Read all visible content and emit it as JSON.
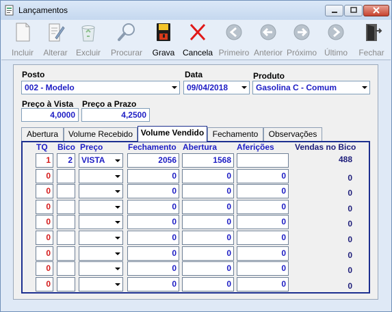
{
  "window": {
    "title": "Lançamentos"
  },
  "toolbar": {
    "items": [
      {
        "label": "Incluir",
        "icon": "new-document-icon",
        "enabled": false
      },
      {
        "label": "Alterar",
        "icon": "edit-document-icon",
        "enabled": false
      },
      {
        "label": "Excluir",
        "icon": "recycle-bin-icon",
        "enabled": false
      },
      {
        "label": "Procurar",
        "icon": "magnifier-icon",
        "enabled": false
      },
      {
        "label": "Grava",
        "icon": "floppy-disk-icon",
        "enabled": true
      },
      {
        "label": "Cancela",
        "icon": "red-x-icon",
        "enabled": true
      },
      {
        "label": "Primeiro",
        "icon": "first-record-icon",
        "enabled": false
      },
      {
        "label": "Anterior",
        "icon": "previous-record-icon",
        "enabled": false
      },
      {
        "label": "Próximo",
        "icon": "next-record-icon",
        "enabled": false
      },
      {
        "label": "Último",
        "icon": "last-record-icon",
        "enabled": false
      },
      {
        "label": "Fechar",
        "icon": "exit-door-icon",
        "enabled": false
      }
    ]
  },
  "form": {
    "posto": {
      "label": "Posto",
      "value": "002 - Modelo"
    },
    "data": {
      "label": "Data",
      "value": "09/04/2018"
    },
    "produto": {
      "label": "Produto",
      "value": "Gasolina C - Comum"
    },
    "preco_vista": {
      "label": "Preço à Vista",
      "value": "4,0000"
    },
    "preco_prazo": {
      "label": "Preço a Prazo",
      "value": "4,2500"
    }
  },
  "tabs": [
    {
      "label": "Abertura",
      "active": false
    },
    {
      "label": "Volume Recebido",
      "active": false
    },
    {
      "label": "Volume Vendido",
      "active": true
    },
    {
      "label": "Fechamento",
      "active": false
    },
    {
      "label": "Observações",
      "active": false
    }
  ],
  "grid": {
    "headers": {
      "tq": "TQ",
      "bico": "Bico",
      "preco": "Preço",
      "fechamento": "Fechamento",
      "abertura": "Abertura",
      "afericoes": "Aferições",
      "vendas": "Vendas no Bico"
    },
    "rows": [
      {
        "tq": "1",
        "bico": "2",
        "preco": "VISTA",
        "fechamento": "2056",
        "abertura": "1568",
        "afericoes": "",
        "vendas": "488"
      },
      {
        "tq": "0",
        "bico": "",
        "preco": "",
        "fechamento": "0",
        "abertura": "0",
        "afericoes": "0",
        "vendas": "0"
      },
      {
        "tq": "0",
        "bico": "",
        "preco": "",
        "fechamento": "0",
        "abertura": "0",
        "afericoes": "0",
        "vendas": "0"
      },
      {
        "tq": "0",
        "bico": "",
        "preco": "",
        "fechamento": "0",
        "abertura": "0",
        "afericoes": "0",
        "vendas": "0"
      },
      {
        "tq": "0",
        "bico": "",
        "preco": "",
        "fechamento": "0",
        "abertura": "0",
        "afericoes": "0",
        "vendas": "0"
      },
      {
        "tq": "0",
        "bico": "",
        "preco": "",
        "fechamento": "0",
        "abertura": "0",
        "afericoes": "0",
        "vendas": "0"
      },
      {
        "tq": "0",
        "bico": "",
        "preco": "",
        "fechamento": "0",
        "abertura": "0",
        "afericoes": "0",
        "vendas": "0"
      },
      {
        "tq": "0",
        "bico": "",
        "preco": "",
        "fechamento": "0",
        "abertura": "0",
        "afericoes": "0",
        "vendas": "0"
      },
      {
        "tq": "0",
        "bico": "",
        "preco": "",
        "fechamento": "0",
        "abertura": "0",
        "afericoes": "0",
        "vendas": "0"
      }
    ]
  }
}
